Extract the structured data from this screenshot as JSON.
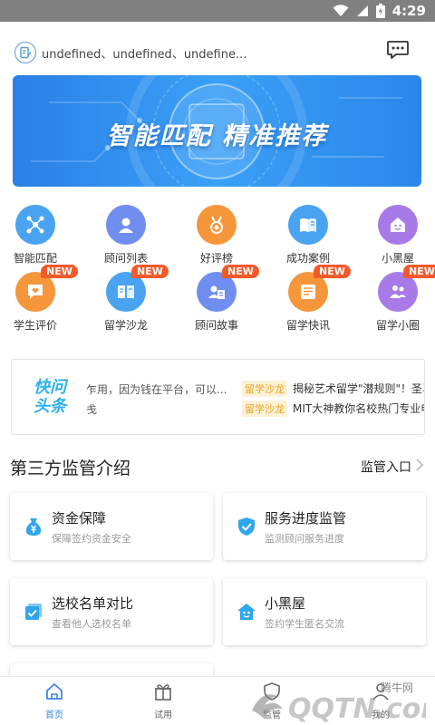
{
  "status_bar": {
    "time": "4:29"
  },
  "header": {
    "text": "undefined、undefined、undefine..."
  },
  "banner": {
    "title": "智能匹配 精准推荐"
  },
  "grid": [
    {
      "label": "智能匹配",
      "color": "#4aa3f0",
      "icon": "match-icon",
      "is_new": false
    },
    {
      "label": "顾问列表",
      "color": "#6f8ef0",
      "icon": "person-icon",
      "is_new": false
    },
    {
      "label": "好评榜",
      "color": "#f5963a",
      "icon": "medal-icon",
      "is_new": false
    },
    {
      "label": "成功案例",
      "color": "#4aa3f0",
      "icon": "book-icon",
      "is_new": false
    },
    {
      "label": "小黑屋",
      "color": "#a77ae8",
      "icon": "house-icon",
      "is_new": false
    },
    {
      "label": "学生评价",
      "color": "#f5963a",
      "icon": "chat-heart-icon",
      "is_new": true
    },
    {
      "label": "留学沙龙",
      "color": "#4aa3f0",
      "icon": "open-book-icon",
      "is_new": true
    },
    {
      "label": "顾问故事",
      "color": "#6f8ef0",
      "icon": "id-card-icon",
      "is_new": true
    },
    {
      "label": "留学快讯",
      "color": "#f5963a",
      "icon": "news-icon",
      "is_new": true
    },
    {
      "label": "留学小圈",
      "color": "#a77ae8",
      "icon": "group-icon",
      "is_new": true
    }
  ],
  "new_badge": "NEW",
  "ticker": {
    "logo_line1": "快问",
    "logo_line2": "头条",
    "left_line1": "乍用，因为钱在平台，可以...",
    "left_line2": "戋",
    "tag1": "留学沙龙",
    "right_line1": "揭秘艺术留学\"潜规则\"！圣马",
    "tag2": "留学沙龙",
    "right_line2": "MIT大神教你名校热门专业申"
  },
  "section": {
    "title": "第三方监管介绍",
    "link": "监管入口"
  },
  "cards": [
    {
      "title": "资金保障",
      "subtitle": "保障签约资金安全",
      "icon": "money-bag-icon"
    },
    {
      "title": "服务进度监管",
      "subtitle": "监测顾问服务进度",
      "icon": "shield-check-icon"
    },
    {
      "title": "选校名单对比",
      "subtitle": "查看他人选校名单",
      "icon": "list-check-icon"
    },
    {
      "title": "小黑屋",
      "subtitle": "签约学生匿名交流",
      "icon": "house-face-icon"
    }
  ],
  "nav": [
    {
      "label": "首页",
      "icon": "home-icon",
      "active": true
    },
    {
      "label": "试用",
      "icon": "gift-icon",
      "active": false
    },
    {
      "label": "监管",
      "icon": "shield-icon",
      "active": false
    },
    {
      "label": "我的",
      "icon": "user-icon",
      "active": false
    }
  ],
  "watermark": {
    "site": "腾牛网",
    "logo": "QQTN.com"
  },
  "colors": {
    "accent": "#3a86e6",
    "badge": "#f35a2a",
    "ticker_logo": "#2fb1ec"
  }
}
